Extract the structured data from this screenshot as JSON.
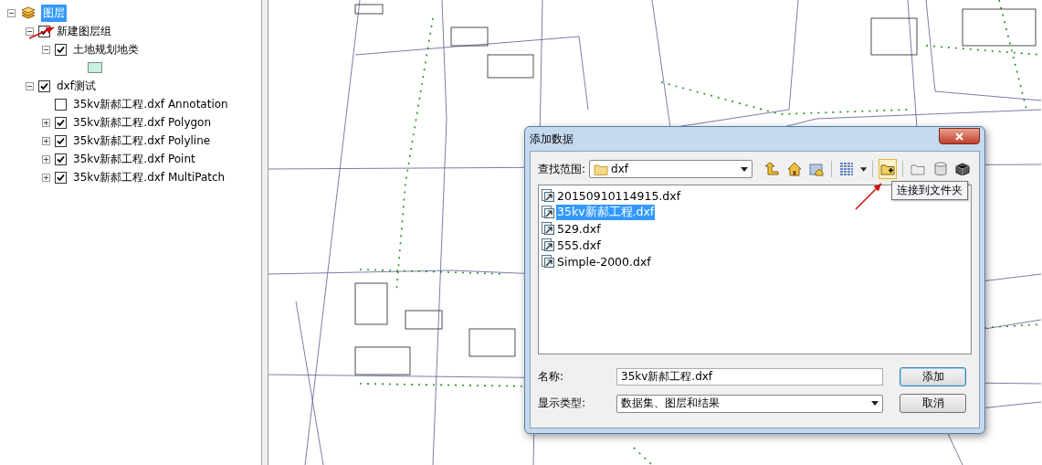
{
  "toc": {
    "root": {
      "label": "图层",
      "selected": true,
      "expanded": true
    },
    "layers": [
      {
        "label": "新建图层组",
        "checked": true,
        "expanded": true,
        "children": [
          {
            "label": "土地规划地类",
            "checked": true,
            "expanded": true,
            "legend_swatch": true
          }
        ]
      },
      {
        "label": "dxf测试",
        "checked": true,
        "expanded": true,
        "children": [
          {
            "label": "35kv新郝工程.dxf Annotation",
            "checked": false
          },
          {
            "label": "35kv新郝工程.dxf Polygon",
            "checked": true,
            "expanded": false
          },
          {
            "label": "35kv新郝工程.dxf Polyline",
            "checked": true,
            "expanded": false
          },
          {
            "label": "35kv新郝工程.dxf Point",
            "checked": true,
            "expanded": false
          },
          {
            "label": "35kv新郝工程.dxf MultiPatch",
            "checked": true,
            "expanded": false
          }
        ]
      }
    ]
  },
  "dialog": {
    "title": "添加数据",
    "look_in_label": "查找范围:",
    "look_in_value": "dxf",
    "files": [
      {
        "name": "20150910114915.dxf",
        "selected": false
      },
      {
        "name": "35kv新郝工程.dxf",
        "selected": true
      },
      {
        "name": "529.dxf",
        "selected": false
      },
      {
        "name": "555.dxf",
        "selected": false
      },
      {
        "name": "Simple-2000.dxf",
        "selected": false
      }
    ],
    "tooltip": "连接到文件夹",
    "name_label": "名称:",
    "name_value": "35kv新郝工程.dxf",
    "type_label": "显示类型:",
    "type_value": "数据集、图层和结果",
    "buttons": [
      {
        "label": "添加",
        "default": true
      },
      {
        "label": "取消",
        "default": false
      }
    ]
  }
}
